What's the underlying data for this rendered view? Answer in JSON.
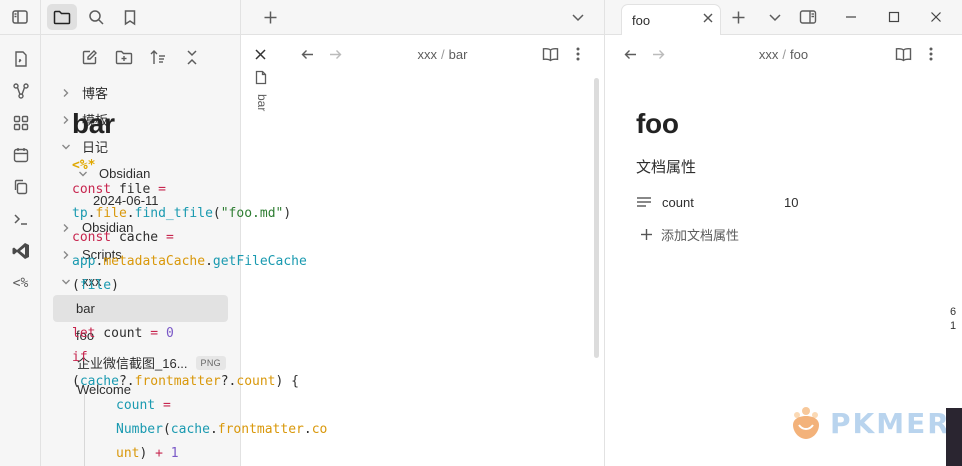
{
  "sidebar": {
    "tree": [
      {
        "label": "博客",
        "type": "folder",
        "state": "collapsed",
        "depth": 0
      },
      {
        "label": "模板",
        "type": "folder",
        "state": "collapsed",
        "depth": 0
      },
      {
        "label": "日记",
        "type": "folder",
        "state": "expanded",
        "depth": 0
      },
      {
        "label": "Obsidian",
        "type": "folder",
        "state": "expanded",
        "depth": 1
      },
      {
        "label": "2024-06-11",
        "type": "file",
        "depth": 2
      },
      {
        "label": "Obsidian",
        "type": "folder",
        "state": "collapsed",
        "depth": 0
      },
      {
        "label": "Scripts",
        "type": "folder",
        "state": "collapsed",
        "depth": 0
      },
      {
        "label": "xxx",
        "type": "folder",
        "state": "expanded",
        "depth": 0
      },
      {
        "label": "bar",
        "type": "file",
        "depth": 1,
        "active": true
      },
      {
        "label": "foo",
        "type": "file",
        "depth": 1
      },
      {
        "label": "企业微信截图_16...",
        "type": "file",
        "depth": 0,
        "badge": "PNG"
      },
      {
        "label": "Welcome",
        "type": "file",
        "depth": 0
      }
    ]
  },
  "left_pane": {
    "vertical_tab": "bar",
    "breadcrumb": {
      "folder": "xxx",
      "sep": "/",
      "file": "bar"
    },
    "title": "bar",
    "code_lines": [
      [
        {
          "t": "<%*",
          "c": "tm"
        }
      ],
      [
        {
          "t": "const",
          "c": "k"
        },
        {
          "t": " file ",
          "c": ""
        },
        {
          "t": "=",
          "c": "k"
        }
      ],
      [
        {
          "t": "tp",
          "c": "f"
        },
        {
          "t": ".",
          "c": ""
        },
        {
          "t": "file",
          "c": "p"
        },
        {
          "t": ".",
          "c": ""
        },
        {
          "t": "find_tfile",
          "c": "f"
        },
        {
          "t": "(",
          "c": ""
        },
        {
          "t": "\"foo.md\"",
          "c": "s"
        },
        {
          "t": ")",
          "c": ""
        }
      ],
      [
        {
          "t": "const",
          "c": "k"
        },
        {
          "t": " cache ",
          "c": ""
        },
        {
          "t": "=",
          "c": "k"
        }
      ],
      [
        {
          "t": "app",
          "c": "f"
        },
        {
          "t": ".",
          "c": ""
        },
        {
          "t": "metadataCache",
          "c": "p"
        },
        {
          "t": ".",
          "c": ""
        },
        {
          "t": "getFileCache",
          "c": "f"
        }
      ],
      [
        {
          "t": "(",
          "c": ""
        },
        {
          "t": "file",
          "c": "f"
        },
        {
          "t": ")",
          "c": ""
        }
      ],
      [],
      [
        {
          "t": "let",
          "c": "k"
        },
        {
          "t": " count ",
          "c": ""
        },
        {
          "t": "=",
          "c": "k"
        },
        {
          "t": " ",
          "c": ""
        },
        {
          "t": "0",
          "c": "n"
        }
      ],
      [
        {
          "t": "if",
          "c": "k"
        }
      ],
      [
        {
          "t": "(",
          "c": ""
        },
        {
          "t": "cache",
          "c": "f"
        },
        {
          "t": "?.",
          "c": ""
        },
        {
          "t": "frontmatter",
          "c": "p"
        },
        {
          "t": "?.",
          "c": ""
        },
        {
          "t": "count",
          "c": "p"
        },
        {
          "t": ") {",
          "c": ""
        }
      ],
      [
        {
          "t": "count",
          "c": "f"
        },
        {
          "t": " ",
          "c": ""
        },
        {
          "t": "=",
          "c": "k"
        }
      ],
      [
        {
          "t": "Number",
          "c": "f"
        },
        {
          "t": "(",
          "c": ""
        },
        {
          "t": "cache",
          "c": "f"
        },
        {
          "t": ".",
          "c": ""
        },
        {
          "t": "frontmatter",
          "c": "p"
        },
        {
          "t": ".",
          "c": ""
        },
        {
          "t": "co",
          "c": "p"
        }
      ],
      [
        {
          "t": "unt",
          "c": "p"
        },
        {
          "t": ") ",
          "c": ""
        },
        {
          "t": "+",
          "c": "k"
        },
        {
          "t": " ",
          "c": ""
        },
        {
          "t": "1",
          "c": "n"
        }
      ]
    ]
  },
  "right_pane": {
    "tab_label": "foo",
    "breadcrumb": {
      "folder": "xxx",
      "sep": "/",
      "file": "foo"
    },
    "title": "foo",
    "properties_heading": "文档属性",
    "properties": [
      {
        "key": "count",
        "value": "10"
      }
    ],
    "add_property_label": "添加文档属性"
  },
  "watermark": {
    "text": "PKMER"
  },
  "edge_text": [
    "6",
    "1"
  ]
}
